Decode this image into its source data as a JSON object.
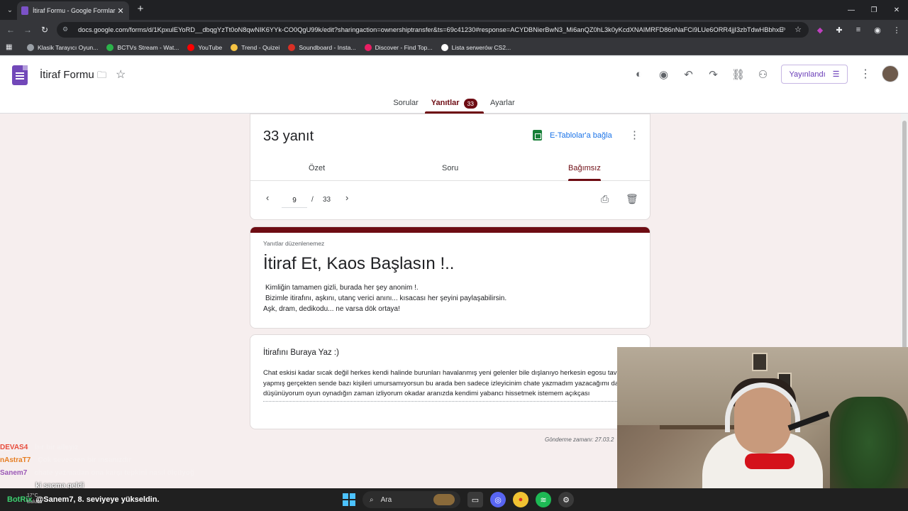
{
  "browser": {
    "tab_title": "İtiraf Formu - Google Formlar",
    "tab_close": "✕",
    "new_tab": "+",
    "url": "docs.google.com/forms/d/1KpxulEYoRD__dbqgYzTt0oN8qwNIK6YYk-CO0QgU99k/edit?sharingaction=ownershiptransfer&ts=69c41230#response=ACYDBNierBwN3_Mi6anQZ0hL3k0yKcdXNAIMRFD86nNaFCi9LUe6ORR4jjI3zbTdwHBbhxE",
    "bookmarks": [
      {
        "label": "Klasik Tarayıcı Oyun...",
        "color": "#9aa0a6"
      },
      {
        "label": "BCTVs Stream - Wat...",
        "color": "#2bb34a"
      },
      {
        "label": "YouTube",
        "color": "#ff0000"
      },
      {
        "label": "Trend - Quizei",
        "color": "#f6c343"
      },
      {
        "label": "Soundboard - Insta...",
        "color": "#d93025"
      },
      {
        "label": "Discover - Find Top...",
        "color": "#e91e63"
      },
      {
        "label": "Lista serwerów CS2...",
        "color": "#ffffff"
      }
    ]
  },
  "header": {
    "form_title": "İtiraf Formu",
    "publish_label": "Yayınlandı",
    "tabs": [
      {
        "label": "Sorular"
      },
      {
        "label": "Yanıtlar",
        "badge": "33"
      },
      {
        "label": "Ayarlar"
      }
    ]
  },
  "summary": {
    "response_count": "33 yanıt",
    "sheets_link": "E-Tablolar'a bağla",
    "sub_tabs": [
      "Özet",
      "Soru",
      "Bağımsız"
    ],
    "current_page": "9",
    "separator": "/",
    "total_pages": "33"
  },
  "form": {
    "not_editable": "Yanıtlar düzenlenemez",
    "title": "İtiraf Et, Kaos Başlasın !..",
    "description_lines": [
      "Kimliğin tamamen gizli, burada her şey anonim !.",
      "Bizimle itirafını, aşkını, utanç verici anını... kısacası her şeyini paylaşabilirsin.",
      "Aşk, dram, dedikodu... ne varsa dök ortaya!"
    ]
  },
  "answer": {
    "question": "İtirafını Buraya Yaz :)",
    "text": "Chat eskisi kadar sıcak değil herkes kendi halinde burunları havalanmış yeni gelenler bile dışlanıyo herkesin egosu tavan yapmış gerçekten sende bazı kişileri umursamıyorsun bu arada ben sadece izleyicinim chate yazmadım yazacağımı da düşünüyorum oyun oynadığın zaman izliyorum okadar aranızda kendimi yabancı hissetmek istemem açıkçası",
    "submit_time": "Gönderme zamanı: 27.03.2"
  },
  "chat": [
    {
      "user": "DEVAS4",
      "color": "#e74c3c",
      "msg": "bir bir aileyiz"
    },
    {
      "user": "nAstraT7",
      "color": "#e67e22",
      "msg": "Çok seveceen bir insanızdır"
    },
    {
      "user": "Sanem7",
      "color": "#9b59b6",
      "msg": "chate yazmadan ona karşı tepkini nasıl ölçüyoğ"
    },
    {
      "user": "",
      "color": "#ffffff",
      "msg": "ki saçma geldi"
    }
  ],
  "taskbar": {
    "weather_temp": "17°C",
    "weather_desc": "Bulutlu",
    "levelup_bot": "BotRix",
    "levelup_text": "@Sanem7, 8. seviyeye yükseldin.",
    "search_label": "Ara"
  },
  "colors": {
    "accent": "#6e0c13",
    "forms_purple": "#7248b9",
    "link_blue": "#1a73e8"
  }
}
